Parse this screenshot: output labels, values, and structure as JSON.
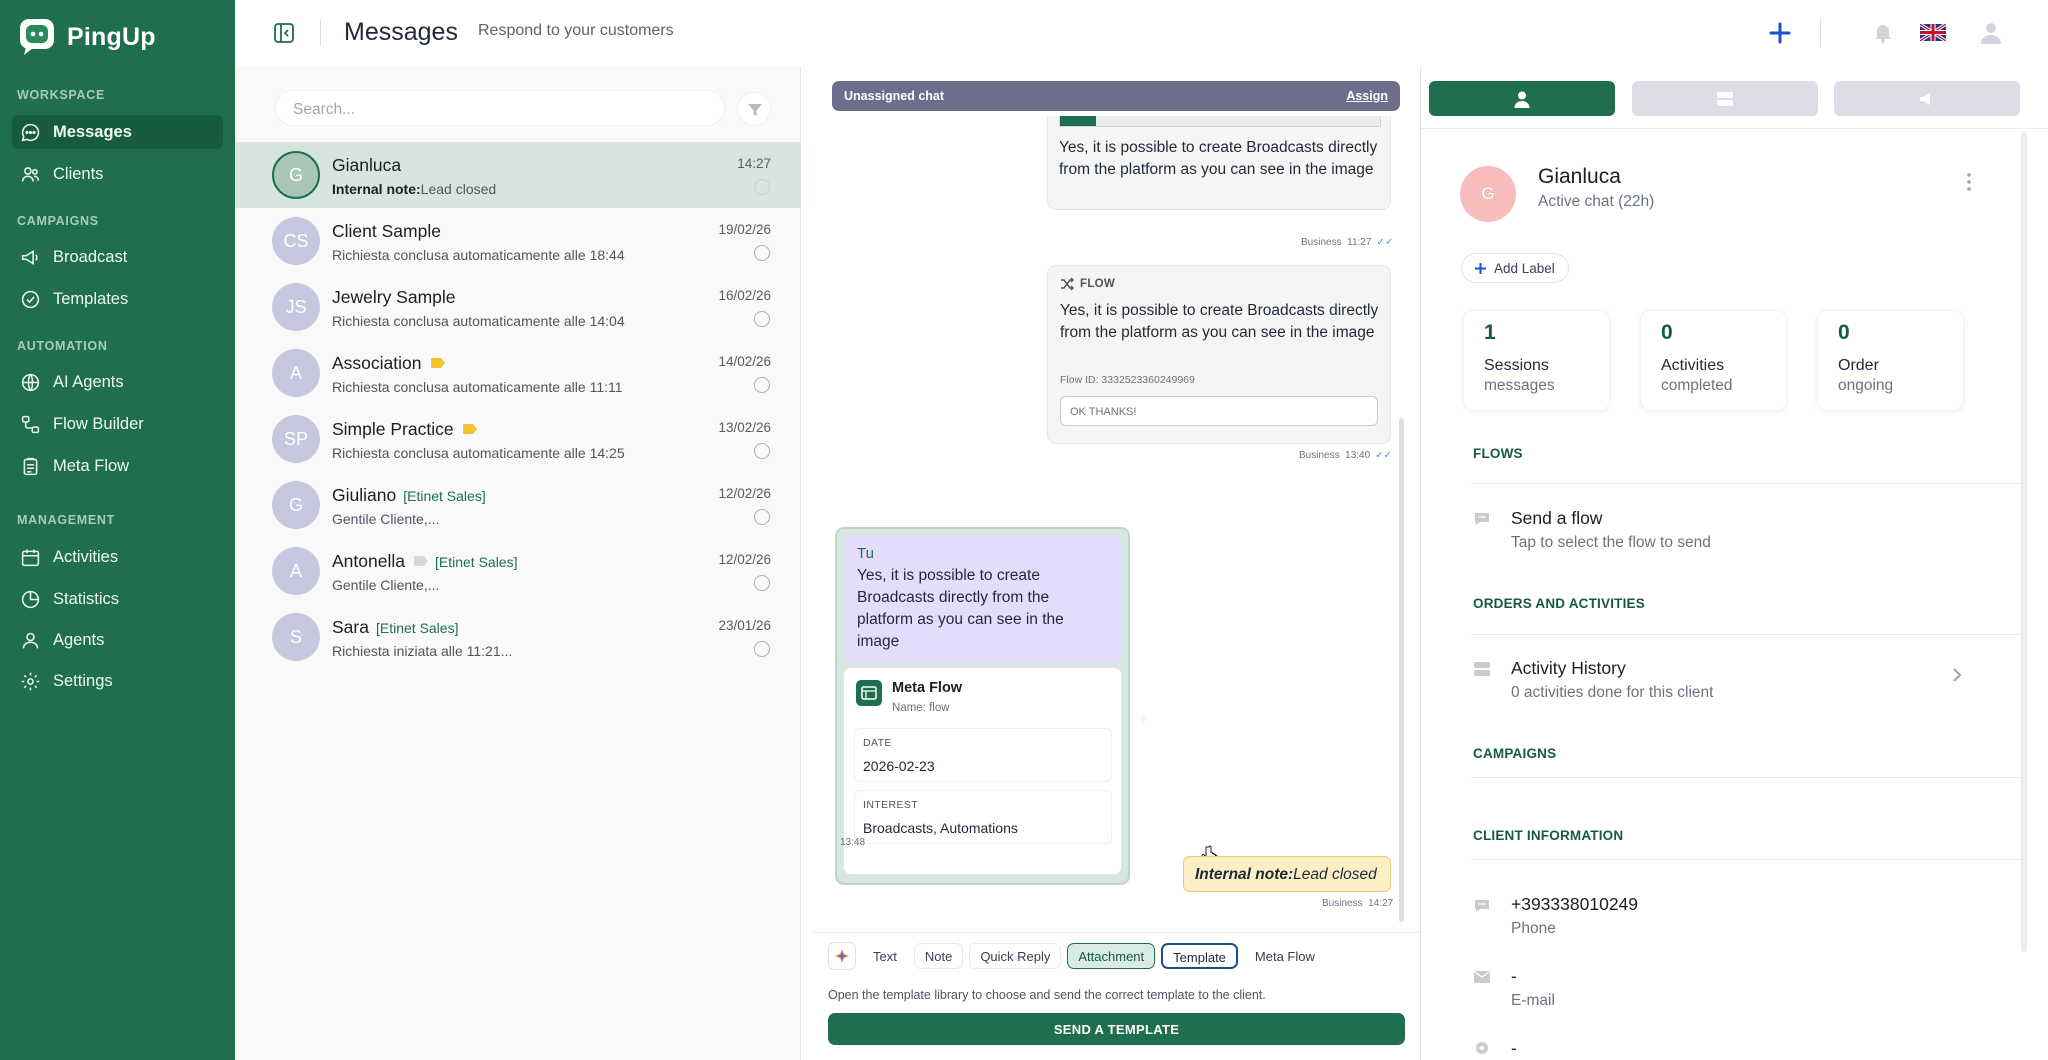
{
  "app": {
    "name": "PingUp"
  },
  "sidebar": {
    "sections": [
      {
        "title": "WORKSPACE"
      },
      {
        "title": "CAMPAIGNS"
      },
      {
        "title": "AUTOMATION"
      },
      {
        "title": "MANAGEMENT"
      }
    ],
    "items": [
      {
        "label": "Messages",
        "icon": "chat-bubble-icon",
        "active": true
      },
      {
        "label": "Clients",
        "icon": "users-icon"
      },
      {
        "label": "Broadcast",
        "icon": "megaphone-icon"
      },
      {
        "label": "Templates",
        "icon": "check-circle-icon"
      },
      {
        "label": "AI Agents",
        "icon": "globe-icon"
      },
      {
        "label": "Flow Builder",
        "icon": "flow-icon"
      },
      {
        "label": "Meta Flow",
        "icon": "clipboard-icon"
      },
      {
        "label": "Activities",
        "icon": "calendar-icon"
      },
      {
        "label": "Statistics",
        "icon": "pie-chart-icon"
      },
      {
        "label": "Agents",
        "icon": "agents-icon"
      },
      {
        "label": "Settings",
        "icon": "gear-icon"
      }
    ]
  },
  "header": {
    "title": "Messages",
    "subtitle": "Respond to your customers"
  },
  "search": {
    "placeholder": "Search..."
  },
  "conversations": [
    {
      "initials": "G",
      "name": "Gianluca",
      "tag": "",
      "note_label": "Internal note:",
      "preview": "Lead closed",
      "time": "14:27",
      "selected": true
    },
    {
      "initials": "CS",
      "name": "Client Sample",
      "tag": "",
      "preview": "Richiesta conclusa automaticamente alle 18:44",
      "time": "19/02/26"
    },
    {
      "initials": "JS",
      "name": "Jewelry Sample",
      "tag": "",
      "preview": "Richiesta conclusa automaticamente alle 14:04",
      "time": "16/02/26"
    },
    {
      "initials": "A",
      "name": "Association",
      "tag": "",
      "preview": "Richiesta conclusa automaticamente alle 11:11",
      "time": "14/02/26",
      "label_color": "#f2c230"
    },
    {
      "initials": "SP",
      "name": "Simple Practice",
      "tag": "",
      "preview": "Richiesta conclusa automaticamente alle 14:25",
      "time": "13/02/26",
      "label_color": "#f2c230"
    },
    {
      "initials": "G",
      "name": "Giuliano",
      "tag": "[Etinet Sales]",
      "preview": "Gentile Cliente,...",
      "time": "12/02/26"
    },
    {
      "initials": "A",
      "name": "Antonella",
      "tag": "[Etinet Sales]",
      "preview": "Gentile Cliente,...",
      "time": "12/02/26",
      "label_color": "#d6d7da"
    },
    {
      "initials": "S",
      "name": "Sara",
      "tag": "[Etinet Sales]",
      "preview": "Richiesta iniziata alle 11:21...",
      "time": "23/01/26"
    }
  ],
  "chat": {
    "banner": "Unassigned chat",
    "assign_label": "Assign",
    "msg1": {
      "text": "Yes, it is possible to create Broadcasts directly from the platform as you can see in the image",
      "sender": "Business",
      "time": "11:27"
    },
    "msg2": {
      "header": "FLOW",
      "text": "Yes, it is possible to create Broadcasts directly from the platform as you can see in the image",
      "flow_id": "Flow ID: 3332523360249969",
      "button": "OK THANKS!",
      "sender": "Business",
      "time": "13:40"
    },
    "msg3": {
      "author": "Tu",
      "text": "Yes, it is possible to create Broadcasts directly from the platform as you can see in the image",
      "card_title": "Meta Flow",
      "card_sub": "Name: flow",
      "fields": [
        {
          "label": "DATE",
          "value": "2026-02-23"
        },
        {
          "label": "INTEREST",
          "value": "Broadcasts, Automations"
        }
      ],
      "time": "13:48"
    },
    "note": {
      "label": "Internal note:",
      "text": "Lead closed",
      "sender": "Business",
      "time": "14:27"
    }
  },
  "composer": {
    "tabs": [
      "Text",
      "Note",
      "Quick Reply",
      "Attachment",
      "Template",
      "Meta Flow"
    ],
    "hint": "Open the template library to choose and send the correct template to the client.",
    "send_label": "SEND A TEMPLATE"
  },
  "contact": {
    "initials": "G",
    "name": "Gianluca",
    "status": "Active chat (22h)",
    "add_label": "Add Label",
    "stats": [
      {
        "value": "1",
        "title": "Sessions",
        "sub": "messages"
      },
      {
        "value": "0",
        "title": "Activities",
        "sub": "completed"
      },
      {
        "value": "0",
        "title": "Order",
        "sub": "ongoing"
      }
    ],
    "sections": {
      "flows": "FLOWS",
      "orders": "ORDERS AND ACTIVITIES",
      "campaigns": "CAMPAIGNS",
      "client_info": "CLIENT INFORMATION"
    },
    "send_flow": {
      "title": "Send a flow",
      "sub": "Tap to select the flow to send"
    },
    "activity": {
      "title": "Activity History",
      "sub": "0 activities done for this client"
    },
    "phone": {
      "value": "+393338010249",
      "label": "Phone"
    },
    "email": {
      "value": "-",
      "label": "E-mail"
    },
    "other": {
      "value": "-"
    }
  },
  "colors": {
    "sidebar": "#1f6e4f",
    "accent": "#1f6e4f",
    "selected_row": "#d7e5df",
    "banner": "#6e6d8c",
    "note_bg": "#fcefc4"
  }
}
